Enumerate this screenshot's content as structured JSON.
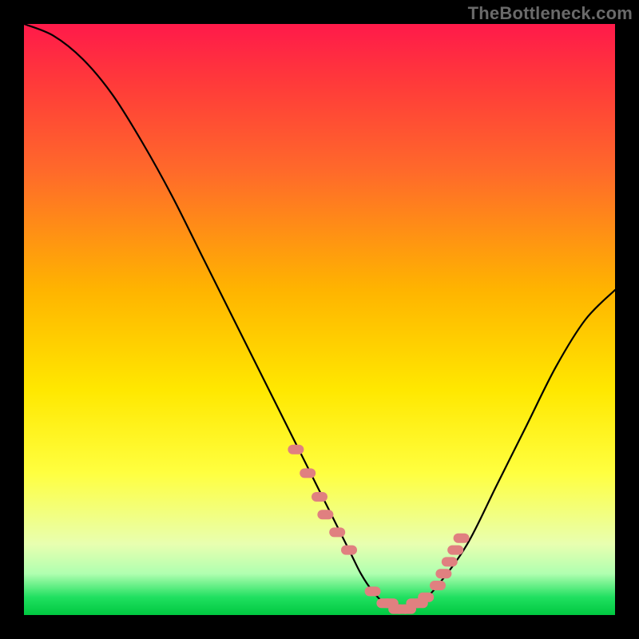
{
  "watermark": "TheBottleneck.com",
  "chart_data": {
    "type": "line",
    "title": "",
    "xlabel": "",
    "ylabel": "",
    "xlim": [
      0,
      100
    ],
    "ylim": [
      0,
      100
    ],
    "series": [
      {
        "name": "curve",
        "x": [
          0,
          5,
          10,
          15,
          20,
          25,
          30,
          35,
          40,
          45,
          50,
          55,
          57,
          59,
          61,
          63,
          65,
          67,
          70,
          75,
          80,
          85,
          90,
          95,
          100
        ],
        "y": [
          100,
          98,
          94,
          88,
          80,
          71,
          61,
          51,
          41,
          31,
          21,
          11,
          7,
          4,
          2,
          1,
          1,
          2,
          5,
          12,
          22,
          32,
          42,
          50,
          55
        ]
      }
    ],
    "markers": {
      "name": "dots",
      "color": "#e08080",
      "x": [
        46,
        48,
        50,
        51,
        53,
        55,
        59,
        61,
        62,
        63,
        64,
        65,
        66,
        67,
        68,
        70,
        71,
        72,
        73,
        74
      ],
      "y": [
        28,
        24,
        20,
        17,
        14,
        11,
        4,
        2,
        2,
        1,
        1,
        1,
        2,
        2,
        3,
        5,
        7,
        9,
        11,
        13
      ]
    }
  }
}
